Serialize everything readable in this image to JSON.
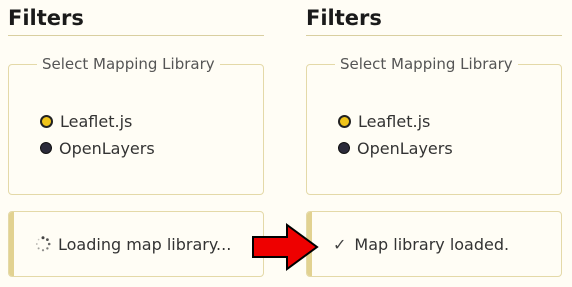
{
  "left_panel": {
    "title": "Filters",
    "fieldset_legend": "Select Mapping Library",
    "options": [
      {
        "label": "Leaflet.js",
        "selected": true
      },
      {
        "label": "OpenLayers",
        "selected": false
      }
    ],
    "status_text": "Loading map library...",
    "status_icon": "spinner-icon"
  },
  "right_panel": {
    "title": "Filters",
    "fieldset_legend": "Select Mapping Library",
    "options": [
      {
        "label": "Leaflet.js",
        "selected": true
      },
      {
        "label": "OpenLayers",
        "selected": false
      }
    ],
    "status_text": "Map library loaded.",
    "status_icon": "check-icon",
    "status_glyph": "✓"
  },
  "transition_icon": "arrow-right-icon",
  "colors": {
    "background": "#fffdf5",
    "border": "#e4d9a8",
    "accent_bar": "#e2d291",
    "radio_selected": "#f0c419",
    "arrow_fill": "#ee0000"
  }
}
